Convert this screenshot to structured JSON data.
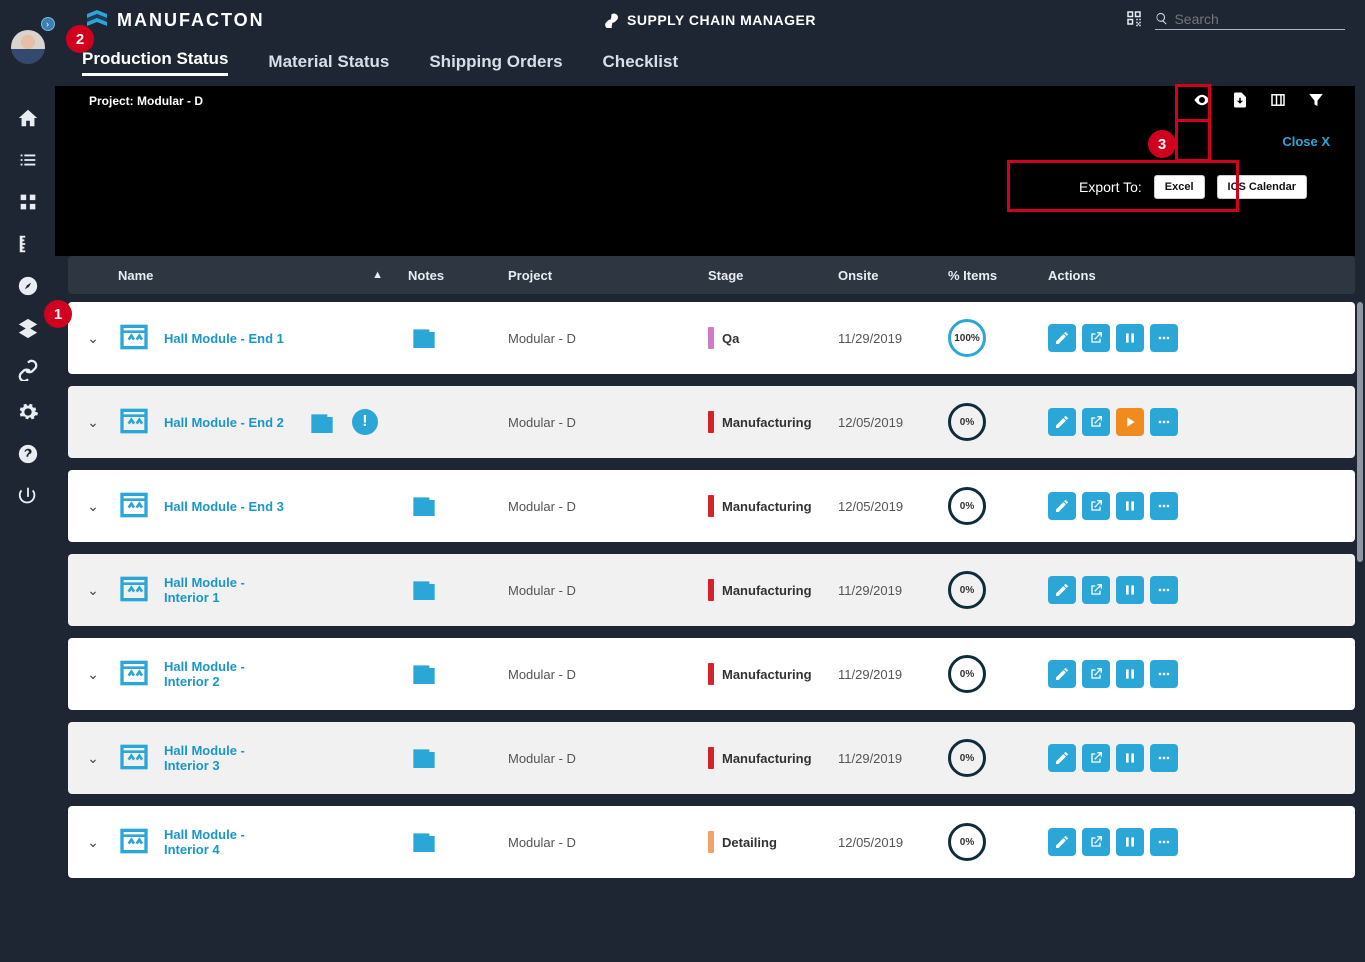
{
  "brand": "MANUFACTON",
  "header_title": "SUPPLY CHAIN MANAGER",
  "search_placeholder": "Search",
  "tabs": {
    "production_status": "Production Status",
    "material_status": "Material Status",
    "shipping_orders": "Shipping Orders",
    "checklist": "Checklist"
  },
  "project_label_prefix": "Project:",
  "project_name": "Modular - D",
  "close_label": "Close X",
  "export_label": "Export To:",
  "export_excel": "Excel",
  "export_ics": "ICS Calendar",
  "columns": {
    "name": "Name",
    "notes": "Notes",
    "project": "Project",
    "stage": "Stage",
    "onsite": "Onsite",
    "items": "% Items",
    "actions": "Actions"
  },
  "rows": [
    {
      "name": "Hall Module - End 1",
      "project": "Modular - D",
      "stage": "Qa",
      "stage_color": "#cf7bc5",
      "onsite": "11/29/2019",
      "pct": "100%",
      "full": true,
      "alt": false,
      "alert": false,
      "play": false
    },
    {
      "name": "Hall Module - End 2",
      "project": "Modular - D",
      "stage": "Manufacturing",
      "stage_color": "#d4232a",
      "onsite": "12/05/2019",
      "pct": "0%",
      "full": false,
      "alt": true,
      "alert": true,
      "play": true
    },
    {
      "name": "Hall Module - End 3",
      "project": "Modular - D",
      "stage": "Manufacturing",
      "stage_color": "#d4232a",
      "onsite": "12/05/2019",
      "pct": "0%",
      "full": false,
      "alt": false,
      "alert": false,
      "play": false
    },
    {
      "name": "Hall Module - Interior 1",
      "project": "Modular - D",
      "stage": "Manufacturing",
      "stage_color": "#d4232a",
      "onsite": "11/29/2019",
      "pct": "0%",
      "full": false,
      "alt": true,
      "alert": false,
      "play": false
    },
    {
      "name": "Hall Module - Interior 2",
      "project": "Modular - D",
      "stage": "Manufacturing",
      "stage_color": "#d4232a",
      "onsite": "11/29/2019",
      "pct": "0%",
      "full": false,
      "alt": false,
      "alert": false,
      "play": false
    },
    {
      "name": "Hall Module - Interior 3",
      "project": "Modular - D",
      "stage": "Manufacturing",
      "stage_color": "#d4232a",
      "onsite": "11/29/2019",
      "pct": "0%",
      "full": false,
      "alt": true,
      "alert": false,
      "play": false
    },
    {
      "name": "Hall Module - Interior 4",
      "project": "Modular - D",
      "stage": "Detailing",
      "stage_color": "#f2a26a",
      "onsite": "12/05/2019",
      "pct": "0%",
      "full": false,
      "alt": false,
      "alert": false,
      "play": false
    }
  ],
  "annotations": {
    "n1": "1",
    "n2": "2",
    "n3": "3"
  }
}
